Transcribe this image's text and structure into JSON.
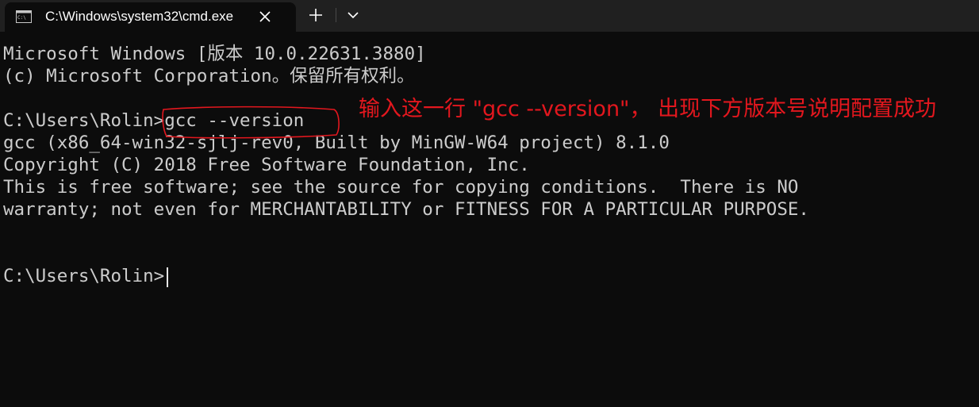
{
  "tab": {
    "title": "C:\\Windows\\system32\\cmd.exe",
    "icon": "cmd-icon"
  },
  "toolbar": {
    "new_tab_icon": "plus-icon",
    "dropdown_icon": "chevron-down-icon"
  },
  "terminal": {
    "lines": [
      "Microsoft Windows [版本 10.0.22631.3880]",
      "(c) Microsoft Corporation。保留所有权利。",
      "",
      "C:\\Users\\Rolin>gcc --version",
      "gcc (x86_64-win32-sjlj-rev0, Built by MinGW-W64 project) 8.1.0",
      "Copyright (C) 2018 Free Software Foundation, Inc.",
      "This is free software; see the source for copying conditions.  There is NO",
      "warranty; not even for MERCHANTABILITY or FITNESS FOR A PARTICULAR PURPOSE.",
      "",
      "",
      "C:\\Users\\Rolin>"
    ]
  },
  "annotation": {
    "text": "输入这一行 \"gcc --version\"， 出现下方版本号说明配置成功",
    "color": "#e3171e"
  },
  "colors": {
    "background": "#0c0c0c",
    "tabbar": "#202020",
    "text": "#cccccc"
  }
}
